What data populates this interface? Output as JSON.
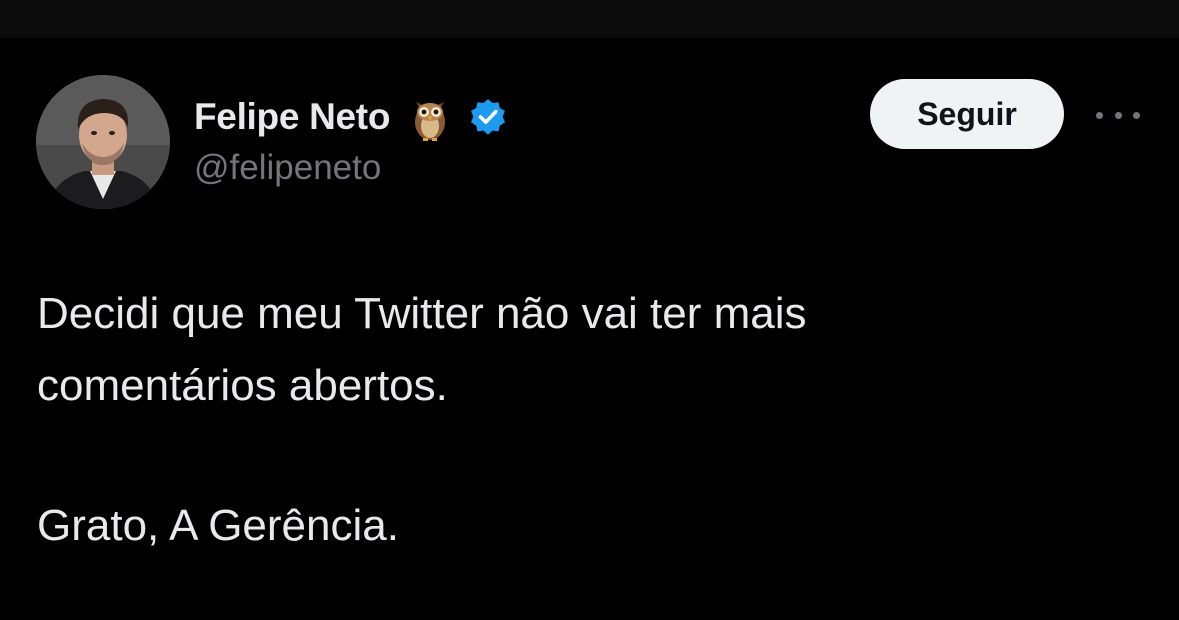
{
  "author": {
    "display_name": "Felipe Neto",
    "handle": "@felipeneto",
    "name_emoji": "owl-icon",
    "verified_color": "#1d9bf0"
  },
  "actions": {
    "follow_label": "Seguir",
    "more_icon": "more-horizontal-icon"
  },
  "tweet": {
    "lines": [
      "Decidi que meu Twitter não vai ter mais",
      "comentários abertos.",
      "Grato, A Gerência."
    ]
  },
  "colors": {
    "background": "#000000",
    "primary_text": "#e7e9ea",
    "secondary_text": "#71767b",
    "button_bg": "#eff3f4",
    "button_text": "#0f1419"
  }
}
